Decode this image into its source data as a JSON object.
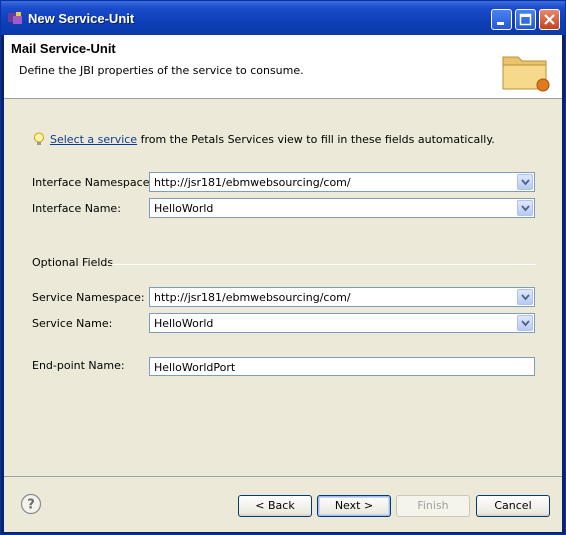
{
  "window": {
    "title": "New Service-Unit"
  },
  "header": {
    "title": "Mail Service-Unit",
    "description": "Define the JBI properties of the service to consume."
  },
  "hint": {
    "link_text": "Select a service",
    "rest_text": " from the Petals Services view to fill in these fields automatically."
  },
  "fields": {
    "interface_namespace": {
      "label": "Interface Namespace:",
      "value": "http://jsr181/ebmwebsourcing/com/"
    },
    "interface_name": {
      "label": "Interface Name:",
      "value": "HelloWorld"
    },
    "optional_group": "Optional Fields",
    "service_namespace": {
      "label": "Service Namespace:",
      "value": "http://jsr181/ebmwebsourcing/com/"
    },
    "service_name": {
      "label": "Service Name:",
      "value": "HelloWorld"
    },
    "endpoint_name": {
      "label": "End-point Name:",
      "value": "HelloWorldPort"
    }
  },
  "buttons": {
    "back": "< Back",
    "next": "Next >",
    "finish": "Finish",
    "cancel": "Cancel"
  }
}
